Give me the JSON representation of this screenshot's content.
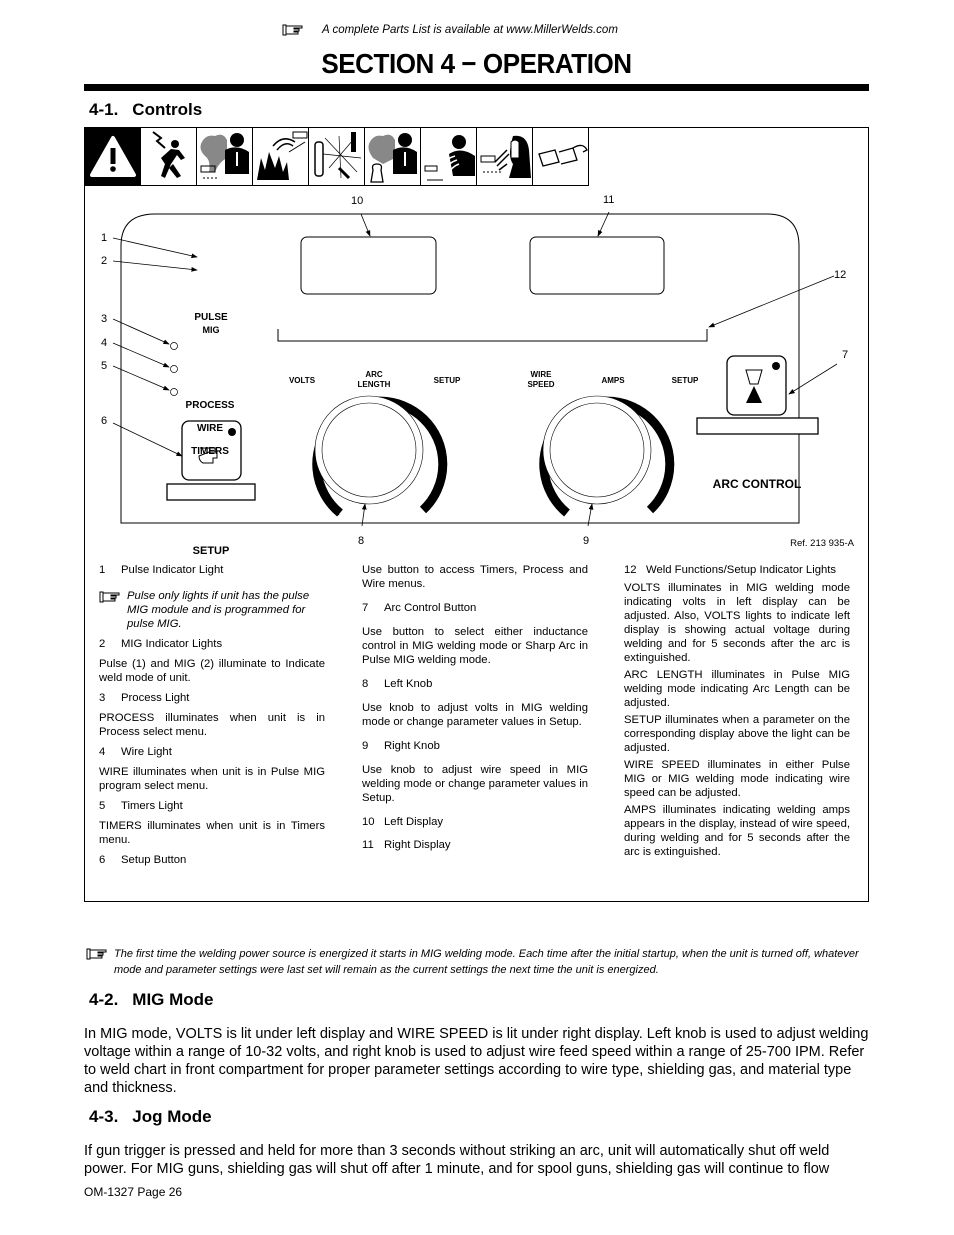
{
  "header": {
    "note_icon": "pointing-hand-icon",
    "note_text": "A complete Parts List is available at www.MillerWelds.com",
    "section_title": "SECTION 4 − OPERATION"
  },
  "section_4_1": {
    "number": "4-1.",
    "title": "Controls",
    "hazard_icons": [
      "warning-triangle-icon",
      "electric-shock-icon",
      "fumes-gases-icon",
      "fire-explosion-icon",
      "cylinder-explosion-icon",
      "gas-breathing-icon",
      "arc-rays-icon",
      "hot-parts-face-shield-icon",
      "safety-glasses-icon"
    ],
    "panel": {
      "pulse_label": "PULSE",
      "mig_label": "MIG",
      "process_label": "PROCESS",
      "wire_label": "WIRE",
      "timers_label": "TIMERS",
      "setup_button_label": "SETUP",
      "arc_control_label": "ARC CONTROL",
      "left_functions": [
        "VOLTS",
        "ARC LENGTH",
        "SETUP"
      ],
      "right_functions": [
        "WIRE SPEED",
        "AMPS",
        "SETUP"
      ],
      "callouts": [
        "1",
        "2",
        "3",
        "4",
        "5",
        "6",
        "7",
        "8",
        "9",
        "10",
        "11",
        "12"
      ],
      "ref": "Ref. 213 935-A"
    },
    "descriptions": {
      "col1": {
        "item1": {
          "n": "1",
          "label": "Pulse Indicator Light"
        },
        "note1": "Pulse only lights if unit has the pulse MIG module and is programmed for pulse MIG.",
        "item2": {
          "n": "2",
          "label": "MIG Indicator Lights"
        },
        "text2": " Pulse (1) and MIG (2) illuminate to Indicate weld mode of unit.",
        "item3": {
          "n": "3",
          "label": "Process Light"
        },
        "text3": "PROCESS illuminates when unit is in Process select menu.",
        "item4": {
          "n": "4",
          "label": "Wire Light"
        },
        "text4": "WIRE illuminates when unit is in Pulse MIG program select menu.",
        "item5": {
          "n": "5",
          "label": "Timers Light"
        },
        "text5": "TIMERS illuminates when unit is in Timers menu.",
        "item6": {
          "n": "6",
          "label": "Setup Button"
        }
      },
      "col2": {
        "text6": "Use button to access Timers, Process and Wire menus.",
        "item7": {
          "n": "7",
          "label": "Arc Control Button"
        },
        "text7": "Use button to select either inductance control in MIG welding mode or Sharp Arc in Pulse MIG welding mode.",
        "item8": {
          "n": "8",
          "label": "Left Knob"
        },
        "text8": "Use knob to adjust volts in MIG welding mode or change parameter values in Setup.",
        "item9": {
          "n": "9",
          "label": "Right Knob"
        },
        "text9": "Use knob to adjust wire speed in MIG welding mode or change parameter values in Setup.",
        "item10": {
          "n": "10",
          "label": "Left Display"
        },
        "item11": {
          "n": "11",
          "label": "Right Display"
        }
      },
      "col3": {
        "item12": {
          "n": "12",
          "label": "Weld Functions/Setup Indicator Lights"
        },
        "volts": "VOLTS illuminates in MIG welding mode indicating volts in left display can be adjusted. Also, VOLTS lights to indicate left display is showing actual voltage during welding and for 5 seconds after the arc is extinguished.",
        "arc_length": "ARC LENGTH illuminates in Pulse MIG welding mode indicating Arc Length can be adjusted.",
        "setup": "SETUP illuminates when a parameter on the corresponding display above the light can be adjusted.",
        "wire_speed": "WIRE SPEED illuminates in either Pulse MIG or MIG welding mode indicating wire speed can be adjusted.",
        "amps": "AMPS illuminates indicating welding amps appears in the display, instead of wire speed, during welding and for 5 seconds after the arc is extinguished."
      }
    },
    "footnote": "The first time the welding power source is energized it starts in MIG welding mode. Each time after the initial startup, when the unit is turned off, whatever mode and parameter settings were last set will remain as the current settings the next time the unit is energized."
  },
  "section_4_2": {
    "number": "4-2.",
    "title": "MIG Mode",
    "body": "In MIG mode, VOLTS is lit under left display and WIRE SPEED is lit under right display. Left knob is used to adjust welding voltage within a range of 10-32 volts, and right knob is used to adjust wire feed speed within a range of 25-700 IPM. Refer to weld chart in front compartment for proper parameter settings according to wire type, shielding gas, and material type and thickness."
  },
  "section_4_3": {
    "number": "4-3.",
    "title": "Jog Mode",
    "body": "If gun trigger is pressed and held for more than 3 seconds without striking an arc, unit will automatically shut off weld power. For MIG guns, shielding gas will shut off after 1 minute, and for spool guns, shielding gas will continue to flow"
  },
  "footer": {
    "page_label": "OM-1327 Page 26"
  }
}
